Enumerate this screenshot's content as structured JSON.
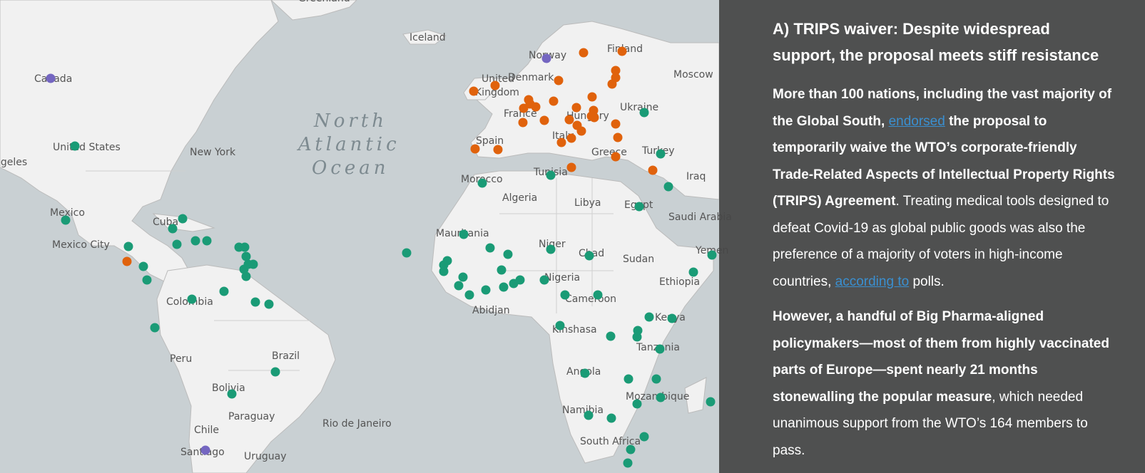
{
  "map": {
    "ocean_label": [
      "North",
      "Atlantic",
      "Ocean"
    ],
    "labels": [
      "Canada",
      "United States",
      "New York",
      "ngeles",
      "Mexico",
      "Mexico City",
      "Cuba",
      "Colombia",
      "Peru",
      "Brazil",
      "Bolivia",
      "Paraguay",
      "Chile",
      "Santiago",
      "Uruguay",
      "Rio de Janeiro",
      "Iceland",
      "Greenland",
      "Norway",
      "Finland",
      "Moscow",
      "United",
      "Kingdom",
      "Denmark",
      "France",
      "Hungary",
      "Ukraine",
      "Spain",
      "Italy",
      "Greece",
      "Turkey",
      "Morocco",
      "Tunisia",
      "Iraq",
      "Algeria",
      "Libya",
      "Egypt",
      "Saudi Arabia",
      "Mauritania",
      "Niger",
      "Chad",
      "Sudan",
      "Yemen",
      "Nigeria",
      "Ethiopia",
      "Cameroon",
      "Abidjan",
      "Kenya",
      "Kinshasa",
      "Tanzania",
      "Angola",
      "Mozambique",
      "Namibia",
      "South Africa"
    ],
    "colors": {
      "support": "#1a9b76",
      "oppose": "#e0620c",
      "other": "#7466c1",
      "land": "#f1f1f1",
      "water": "#c9d0d3"
    }
  },
  "panel": {
    "title": "A) TRIPS waiver: Despite widespread support, the proposal meets stiff resistance",
    "p1_bold_a": "More than 100 nations, including the vast majority of the Global South,",
    "p1_link1": "endorsed",
    "p1_bold_b": "the proposal to temporarily waive the WTO’s corporate-friendly Trade-Related Aspects of Intellectual Property Rights (TRIPS) Agreement",
    "p1_text": ". Treating medical tools designed to defeat Covid-19 as global public goods was also the preference of a majority of voters in high-income countries,",
    "p1_link2": "according to",
    "p1_end": "polls.",
    "p2_bold": "However, a handful of Big Pharma-aligned policymakers—most of them from highly vaccinated parts of Europe—spent nearly 21 months stonewalling the popular measure",
    "p2_text": ", which needed unanimous support from the WTO’s 164 members to pass."
  }
}
